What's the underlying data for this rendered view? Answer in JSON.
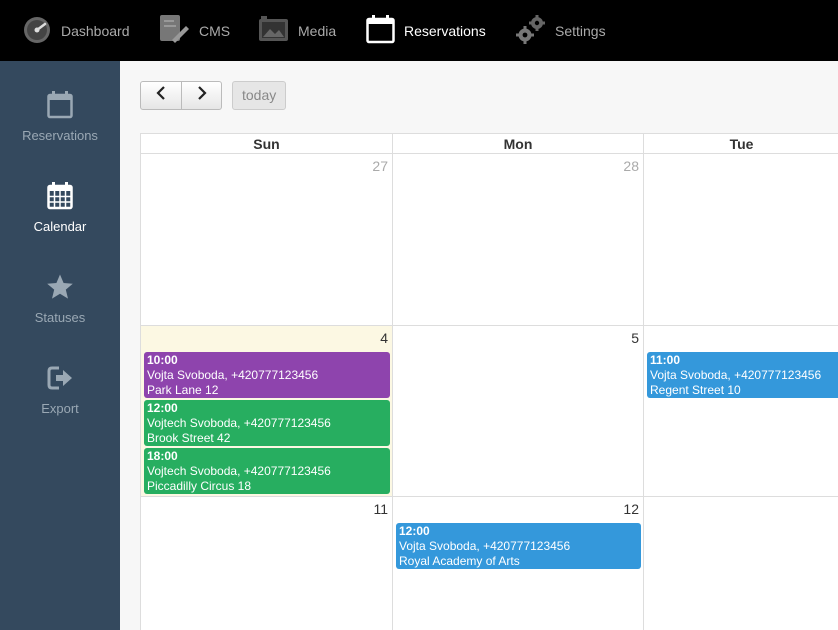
{
  "topnav": {
    "dashboard": "Dashboard",
    "cms": "CMS",
    "media": "Media",
    "reservations": "Reservations",
    "settings": "Settings"
  },
  "sidebar": {
    "reservations": "Reservations",
    "calendar": "Calendar",
    "statuses": "Statuses",
    "export": "Export"
  },
  "toolbar": {
    "today_label": "today"
  },
  "calendar": {
    "days": [
      "Sun",
      "Mon",
      "Tue"
    ],
    "weeks": [
      [
        "27",
        "28",
        ""
      ],
      [
        "4",
        "5",
        ""
      ],
      [
        "11",
        "12",
        ""
      ]
    ],
    "events": [
      {
        "time": "10:00",
        "line1": "Vojta Svoboda, +420777123456",
        "line2": "Park Lane 12"
      },
      {
        "time": "12:00",
        "line1": "Vojtech Svoboda, +420777123456",
        "line2": "Brook Street 42"
      },
      {
        "time": "18:00",
        "line1": "Vojtech Svoboda, +420777123456",
        "line2": "Piccadilly Circus 18"
      },
      {
        "time": "11:00",
        "line1": "Vojta Svoboda, +420777123456",
        "line2": "Regent Street 10"
      },
      {
        "time": "12:00",
        "line1": "Vojta Svoboda, +420777123456",
        "line2": "Royal Academy of Arts"
      }
    ]
  },
  "colors": {
    "purple": "#8e44ad",
    "green": "#27ae60",
    "blue": "#3498db",
    "sidebar": "#34495e",
    "today_bg": "#fcf8e3"
  }
}
